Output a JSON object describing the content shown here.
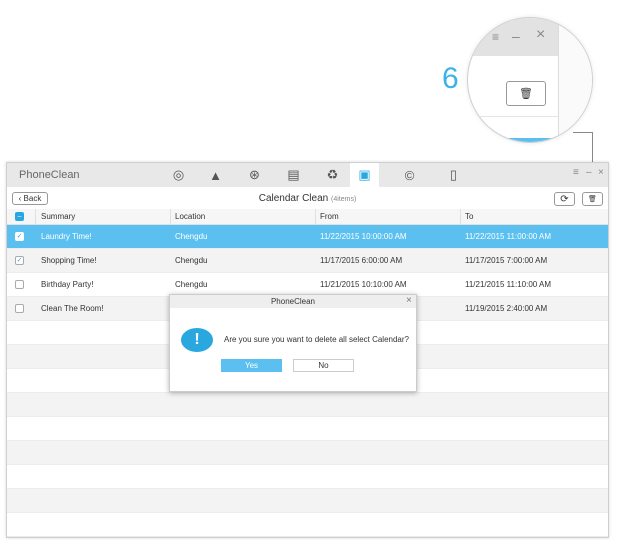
{
  "step_number": "6",
  "app": {
    "name": "PhoneClean",
    "window_controls": {
      "menu": "≡",
      "minimize": "–",
      "close": "×"
    }
  },
  "tabs": [
    {
      "icon": "quick-clean-icon",
      "glyph": "◎"
    },
    {
      "icon": "broom-icon",
      "glyph": "▲"
    },
    {
      "icon": "internet-clean-icon",
      "glyph": "⊛"
    },
    {
      "icon": "basket-icon",
      "glyph": "▤"
    },
    {
      "icon": "recycle-bin-icon",
      "glyph": "♻"
    },
    {
      "icon": "toolbox-icon",
      "glyph": "▣",
      "active": true
    },
    {
      "icon": "copyright-icon",
      "glyph": "©"
    },
    {
      "icon": "phone-info-icon",
      "glyph": "▯"
    }
  ],
  "toolbar": {
    "back_label": "Back",
    "title": "Calendar Clean",
    "count": "(4items)",
    "refresh_glyph": "⟳",
    "delete_glyph": "🗑"
  },
  "table": {
    "headers": [
      "Summary",
      "Location",
      "From",
      "To"
    ],
    "rows": [
      {
        "checked": true,
        "selected": true,
        "summary": "Laundry Time!",
        "location": "Chengdu",
        "from": "11/22/2015 10:00:00 AM",
        "to": "11/22/2015 11:00:00 AM"
      },
      {
        "checked": true,
        "selected": false,
        "summary": "Shopping Time!",
        "location": "Chengdu",
        "from": "11/17/2015 6:00:00 AM",
        "to": "11/17/2015 7:00:00 AM"
      },
      {
        "checked": false,
        "selected": false,
        "summary": "Birthday Party!",
        "location": "Chengdu",
        "from": "11/21/2015 10:10:00 AM",
        "to": "11/21/2015 11:10:00 AM"
      },
      {
        "checked": false,
        "selected": false,
        "summary": "Clean The Room!",
        "location": "",
        "from": "",
        "to": "11/19/2015 2:40:00 AM"
      }
    ]
  },
  "dialog": {
    "title": "PhoneClean",
    "message": "Are you sure you want to delete all select Calendar?",
    "yes": "Yes",
    "no": "No",
    "close": "×"
  },
  "colors": {
    "accent": "#5bc0ef",
    "step": "#3bb2ea"
  }
}
